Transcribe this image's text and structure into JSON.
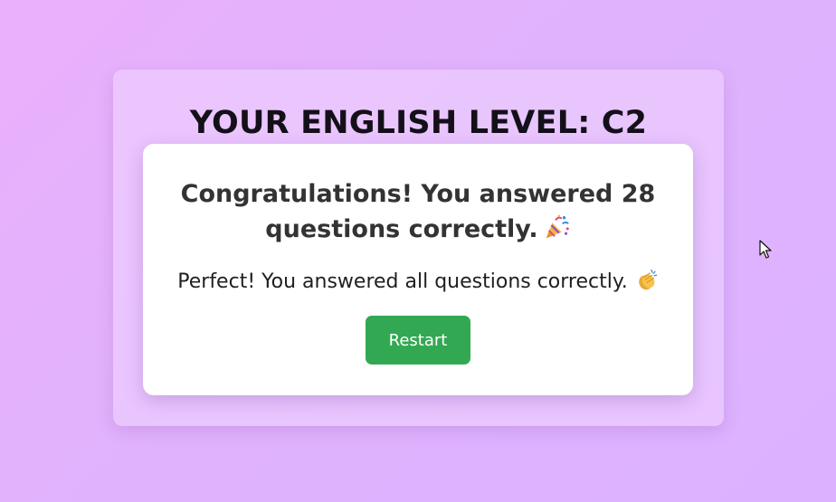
{
  "result": {
    "level_title": "YOUR ENGLISH LEVEL: C2",
    "congrats_text": "Congratulations! You answered 28 questions correctly.",
    "congrats_icon": "party-popper-icon",
    "perfect_text": "Perfect! You answered all questions correctly.",
    "perfect_icon": "clapping-hands-icon",
    "restart_label": "Restart"
  },
  "colors": {
    "background_start": "#ebb0fb",
    "background_end": "#dcb2ff",
    "button": "#32a852",
    "heading_text": "#14101a",
    "body_text": "#333333"
  }
}
